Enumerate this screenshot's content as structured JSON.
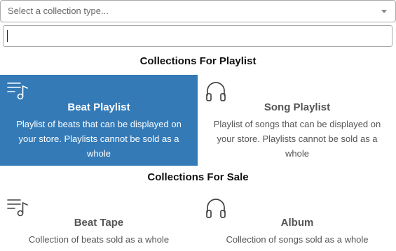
{
  "select": {
    "placeholder": "Select a collection type..."
  },
  "search": {
    "value": ""
  },
  "groups": [
    {
      "heading": "Collections For Playlist",
      "options": [
        {
          "title": "Beat Playlist",
          "description": "Playlist of beats that can be displayed on your store. Playlists cannot be sold as a whole",
          "icon": "playlist-music-icon",
          "selected": true
        },
        {
          "title": "Song Playlist",
          "description": "Playlist of songs that can be displayed on your store. Playlists cannot be sold as a whole",
          "icon": "headphones-icon",
          "selected": false
        }
      ]
    },
    {
      "heading": "Collections For Sale",
      "options": [
        {
          "title": "Beat Tape",
          "description": "Collection of beats sold as a whole",
          "icon": "playlist-music-icon",
          "selected": false
        },
        {
          "title": "Album",
          "description": "Collection of songs sold as a whole",
          "icon": "headphones-icon",
          "selected": false
        }
      ]
    }
  ],
  "colors": {
    "selected_background": "#337ab7",
    "selected_text": "#ffffff",
    "text_muted": "#555555",
    "heading": "#111111"
  }
}
